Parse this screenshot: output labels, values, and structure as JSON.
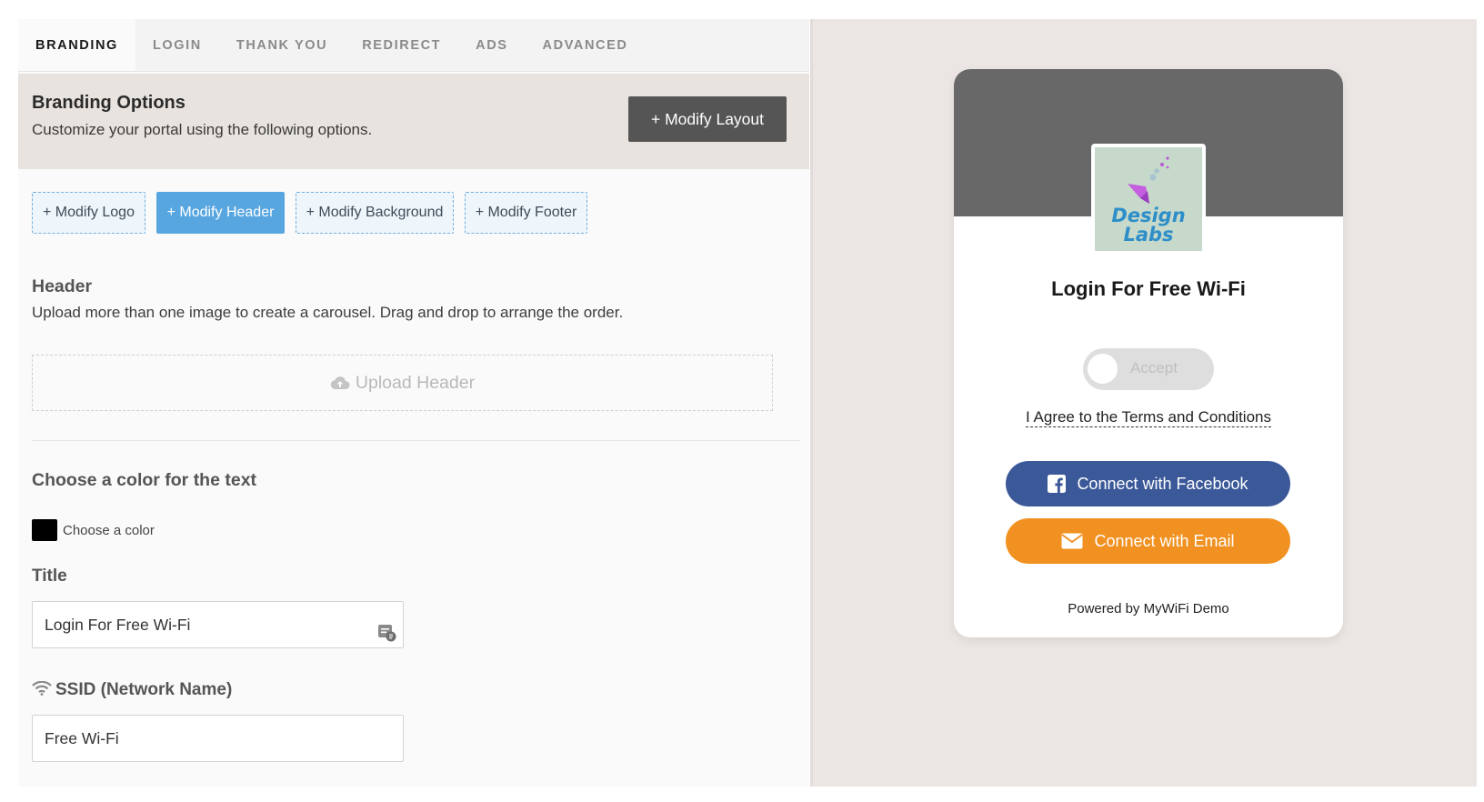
{
  "tabs": [
    {
      "label": "BRANDING"
    },
    {
      "label": "LOGIN"
    },
    {
      "label": "THANK YOU"
    },
    {
      "label": "REDIRECT"
    },
    {
      "label": "ADS"
    },
    {
      "label": "ADVANCED"
    }
  ],
  "branding": {
    "title": "Branding Options",
    "subtitle": "Customize your portal using the following options.",
    "modify_layout": "+ Modify Layout"
  },
  "modify_buttons": {
    "logo": "+ Modify Logo",
    "header": "+ Modify Header",
    "background": "+ Modify Background",
    "footer": "+ Modify Footer"
  },
  "header_section": {
    "title": "Header",
    "description": "Upload more than one image to create a carousel. Drag and drop to arrange the order.",
    "upload_label": "Upload Header"
  },
  "text_color": {
    "title": "Choose a color for the text",
    "choose_label": "Choose a color",
    "swatch_color": "#000000"
  },
  "title_field": {
    "label": "Title",
    "value": "Login For Free Wi-Fi"
  },
  "ssid_field": {
    "label": "SSID (Network Name)",
    "value": "Free Wi-Fi"
  },
  "preview": {
    "logo_text_1": "Design",
    "logo_text_2": "Labs",
    "title": "Login For Free Wi-Fi",
    "toggle_label": "Accept",
    "terms": "I Agree to the Terms and Conditions",
    "facebook_button": "Connect with Facebook",
    "email_button": "Connect with Email",
    "powered_by": "Powered by MyWiFi Demo"
  },
  "colors": {
    "facebook": "#3b5998",
    "email": "#f19121",
    "active_button": "#58a6e0",
    "dark_button": "#555555"
  }
}
